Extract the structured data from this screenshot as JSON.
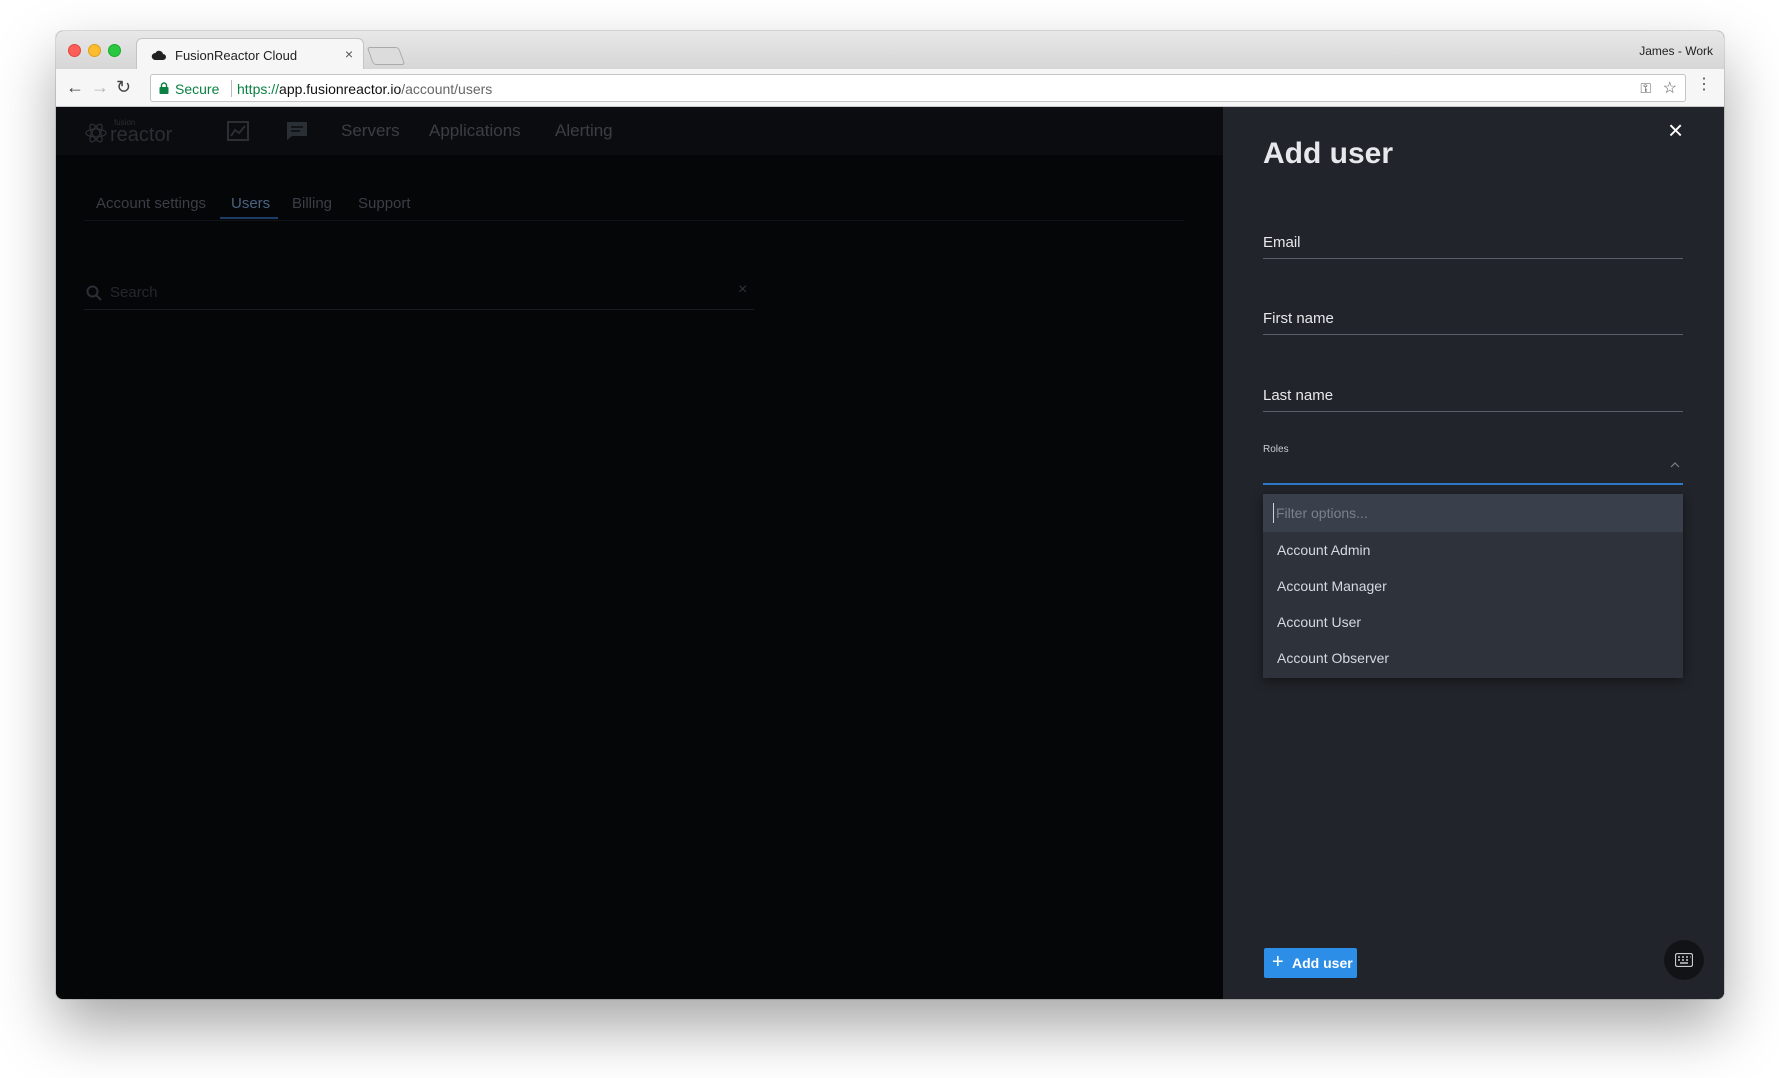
{
  "browser": {
    "tab_title": "FusionReactor Cloud",
    "tab_close": "×",
    "profile_name": "James - Work",
    "secure_label": "Secure",
    "url_scheme": "https://",
    "url_host": "app.fusionreactor.io",
    "url_path": "/account/users",
    "icons": [
      "back-icon",
      "forward-icon",
      "reload-icon",
      "lock-icon",
      "key-icon",
      "star-icon",
      "menu-icon",
      "cloud-icon"
    ]
  },
  "app": {
    "logo_small": "fusion",
    "logo_main": "reactor",
    "nav": [
      "Servers",
      "Applications",
      "Alerting"
    ],
    "sub_nav": [
      "Account settings",
      "Users",
      "Billing",
      "Support"
    ],
    "active_sub_nav": "Users",
    "search_placeholder": "Search",
    "search_clear": "×"
  },
  "panel": {
    "title": "Add user",
    "close": "×",
    "fields": {
      "email": "Email",
      "first_name": "First name",
      "last_name": "Last name",
      "roles": "Roles"
    },
    "filter_placeholder": "Filter options...",
    "role_options": [
      "Account Admin",
      "Account Manager",
      "Account User",
      "Account Observer"
    ],
    "add_button": "Add user",
    "add_button_icon": "+"
  },
  "colors": {
    "panel_bg": "#21242a",
    "overlay_bg": "#050608",
    "accent_blue": "#2d8ee8",
    "focus_line": "#2e78c8",
    "dropdown_bg": "#2d323b"
  }
}
